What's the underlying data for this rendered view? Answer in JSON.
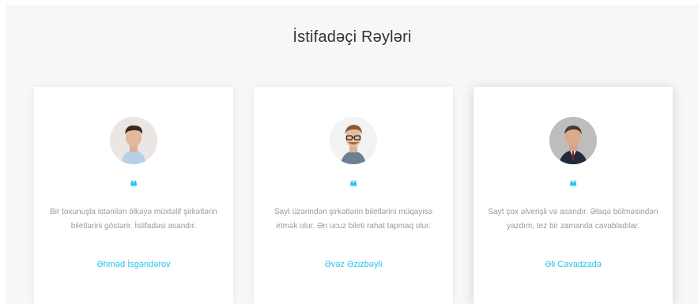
{
  "section": {
    "title": "İstifadəçi Rəyləri"
  },
  "colors": {
    "accent": "#27c4ef",
    "body_text": "#9a9a9a",
    "background": "#f7f7f7"
  },
  "quote_glyph": "❝",
  "testimonials": [
    {
      "text": "Bir toxunuşla istənilən ölkəyə müxtəlif şirkətlərin biletlərini göstərir. İstifadəsi asandır.",
      "author": "Əhməd İsgəndərov",
      "avatar_icon": "person-avatar-icon"
    },
    {
      "text": "Sayt üzərindən şirkətlərin biletlərini müqayisə etmək olur. Ən ucuz bileti rahat tapmaq olur.",
      "author": "Əvəz Əzizbəyli",
      "avatar_icon": "person-avatar-icon"
    },
    {
      "text": "Sayt çox əlverişli və asandır. Əlaqə bölməsindən yazdım, tez bir zamanda cavabladılar.",
      "author": "Əli Cavadzadə",
      "avatar_icon": "person-avatar-icon"
    }
  ]
}
